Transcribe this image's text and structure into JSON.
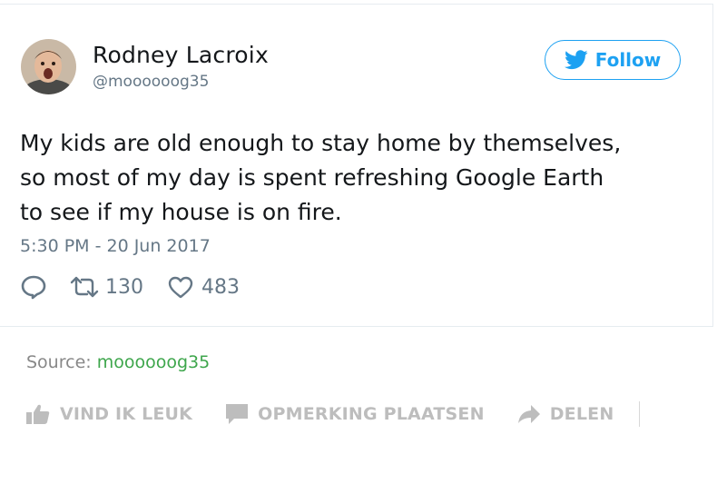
{
  "tweet": {
    "display_name": "Rodney Lacroix",
    "handle": "@moooooog35",
    "follow_label": "Follow",
    "text": "My kids are old enough to stay home by themselves,\nso most of my day is spent refreshing Google Earth\nto see if my house is on fire.",
    "timestamp": "5:30 PM - 20 Jun 2017",
    "retweets": "130",
    "likes": "483"
  },
  "source": {
    "label": "Source:",
    "link": "moooooog35"
  },
  "social_bar": {
    "like_label": "VIND IK LEUK",
    "comment_label": "OPMERKING PLAATSEN",
    "share_label": "DELEN"
  },
  "colors": {
    "twitter_blue": "#1da1f2",
    "source_green": "#3ea64c",
    "muted_gray": "#657786"
  },
  "icons": {
    "follow": "twitter-bird-icon",
    "reply": "reply-icon",
    "retweet": "retweet-icon",
    "like": "heart-icon",
    "thumbs_up": "thumbs-up-icon",
    "comment": "comment-icon",
    "share": "share-arrow-icon"
  }
}
